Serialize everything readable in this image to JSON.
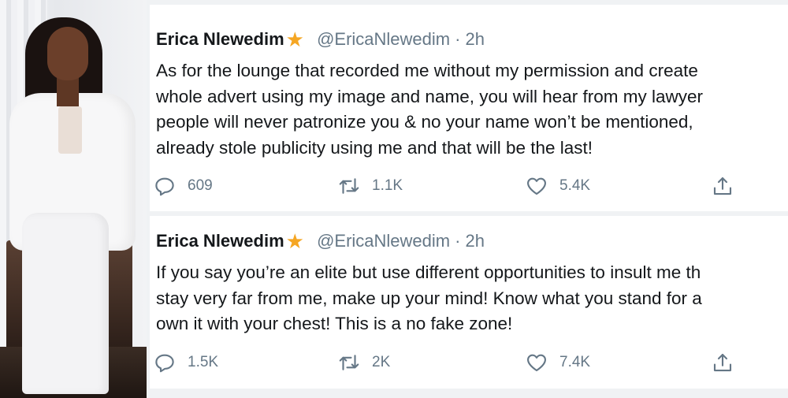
{
  "tweets": [
    {
      "author_name": "Erica Nlewedim",
      "verified_icon": "star-icon",
      "handle": "@EricaNlewedim",
      "separator": "·",
      "time": "2h",
      "lines": [
        "As for the lounge that recorded me without my permission and create",
        "whole advert using my image and name, you will hear from my lawyer",
        "people will never patronize you & no your name won’t be mentioned,",
        "already stole publicity using me and that will be the last!"
      ],
      "replies": "609",
      "retweets": "1.1K",
      "likes": "5.4K"
    },
    {
      "author_name": "Erica Nlewedim",
      "verified_icon": "star-icon",
      "handle": "@EricaNlewedim",
      "separator": "·",
      "time": "2h",
      "lines": [
        "If you say you’re an elite but use different opportunities to insult me th",
        "stay very far from me, make up your mind! Know what you stand for a",
        "own it with your chest! This is a no fake zone!"
      ],
      "replies": "1.5K",
      "retweets": "2K",
      "likes": "7.4K"
    }
  ],
  "colors": {
    "text": "#14171a",
    "muted": "#657786",
    "star": "#f5a623",
    "background": "#f0f2f4"
  }
}
